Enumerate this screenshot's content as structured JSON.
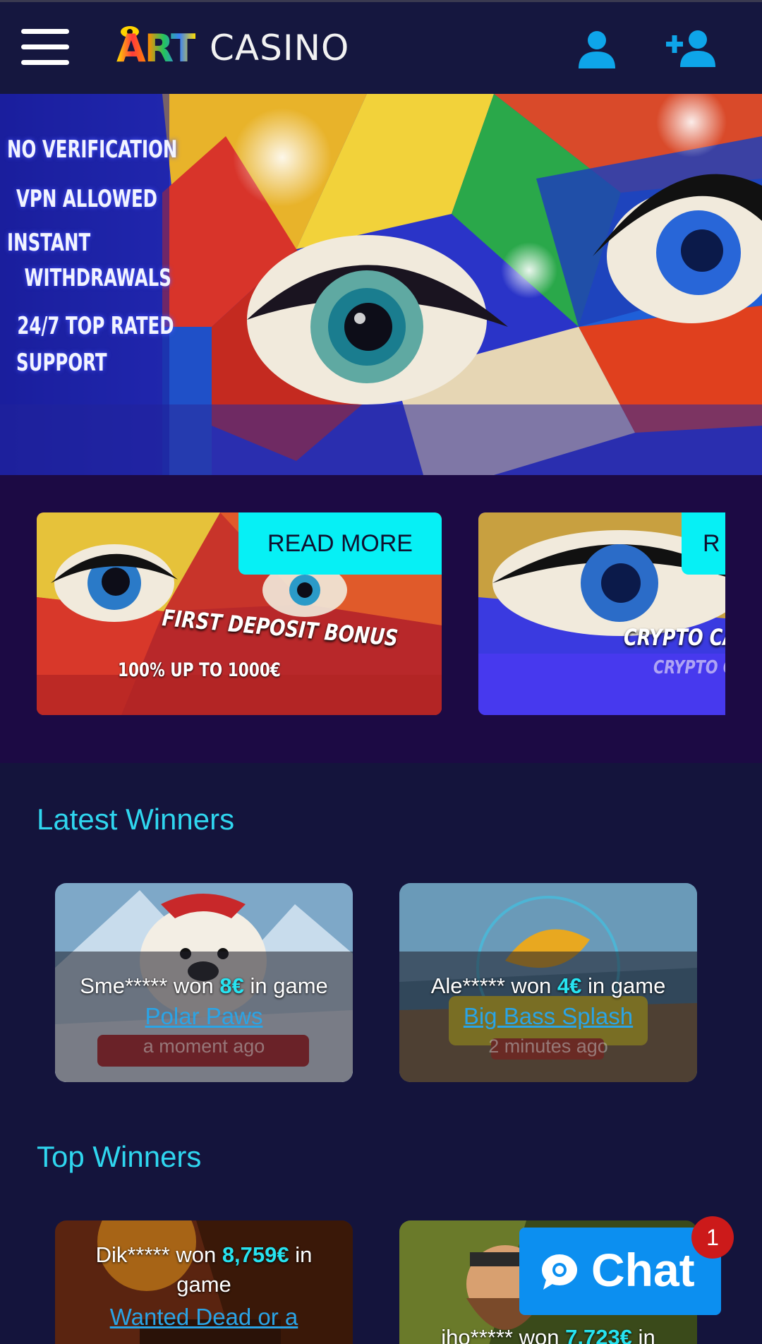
{
  "header": {
    "logo_art": "ART",
    "logo_casino": "CASINO",
    "menu_icon": "hamburger-icon",
    "login_icon": "user-icon",
    "register_icon": "user-plus-icon",
    "accent_color": "#0ea5e9"
  },
  "hero": {
    "features": [
      "NO VERIFICATION",
      "VPN ALLOWED",
      "INSTANT",
      "WITHDRAWALS",
      "24/7 TOP RATED",
      "SUPPORT"
    ]
  },
  "promotions": [
    {
      "button": "READ MORE",
      "title": "FIRST DEPOSIT BONUS",
      "subtitle": "100% UP TO 1000€"
    },
    {
      "button": "R",
      "title": "CRYPTO CA",
      "subtitle": "CRYPTO C"
    }
  ],
  "latest_winners": {
    "title": "Latest Winners",
    "items": [
      {
        "user": "Sme*****",
        "won": " won ",
        "amount": "8€",
        "in_game": " in game",
        "game": "Polar Paws",
        "time": "a moment ago"
      },
      {
        "user": "Ale*****",
        "won": " won ",
        "amount": "4€",
        "in_game": " in game",
        "game": "Big Bass Splash",
        "time": "2 minutes ago"
      }
    ]
  },
  "top_winners": {
    "title": "Top Winners",
    "items": [
      {
        "user": "Dik*****",
        "won": " won ",
        "amount": "8,759€",
        "in_game": " in",
        "line2": "game",
        "game": "Wanted Dead or a"
      },
      {
        "user": "iho*****",
        "won": " won ",
        "amount": "7,723€",
        "in_game": " in"
      }
    ]
  },
  "chat": {
    "label": "Chat",
    "badge": "1",
    "icon": "chat-bubble-icon"
  }
}
